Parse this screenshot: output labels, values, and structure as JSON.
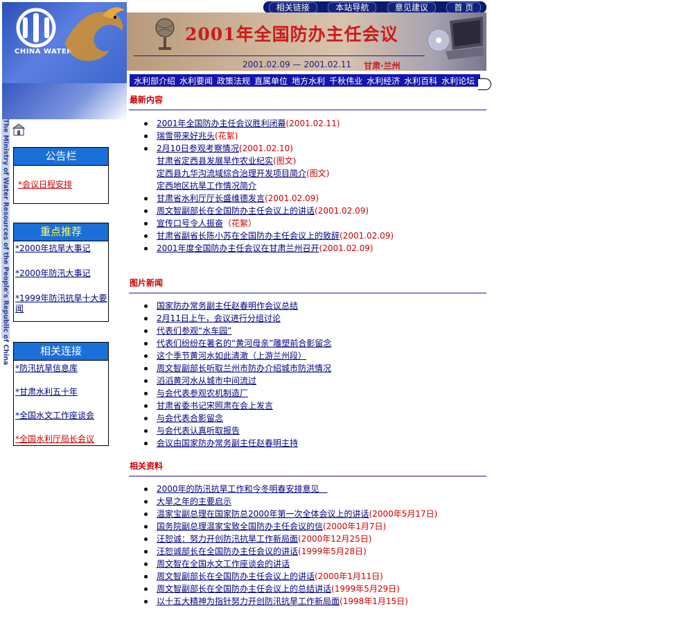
{
  "logo": {
    "text": "CHINA WATER"
  },
  "top_nav": [
    "相关链接",
    "本站导航",
    "意见建议",
    "首 页"
  ],
  "banner": {
    "title": "2001年全国防办主任会议",
    "dates": "2001.02.09 — 2001.02.11",
    "place": "甘肃·兰州"
  },
  "sub_nav": [
    "水利部介绍",
    "水利要闻",
    "政策法规",
    "直属单位",
    "地方水利",
    "千秋伟业",
    "水利经济",
    "水利百科",
    "水利论坛"
  ],
  "side_text": "The Ministry of Water Resources of the People's Republic of China",
  "sidebar": {
    "notice": {
      "title": "公告栏",
      "items": [
        "*会议日程安排"
      ]
    },
    "featured": {
      "title": "重点推荐",
      "items": [
        "*2000年抗旱大事记",
        "*2000年防汛大事记",
        "*1999年防汛抗旱十大要闻"
      ]
    },
    "links": {
      "title": "相关连接",
      "items": [
        "*防汛抗旱信息库",
        "*甘肃水利五十年",
        "*全国水文工作座谈会",
        "*全国水利厅局长会议"
      ]
    }
  },
  "sections": [
    {
      "title": "最新内容",
      "items": [
        {
          "text": "2001年全国防办主任会议胜利闭幕",
          "meta": "(2001.02.11)",
          "bullet": true
        },
        {
          "text": "瑞雪带来好兆头",
          "meta": "(花絮)",
          "bullet": true
        },
        {
          "text": "2月10日参观考察情况",
          "meta": "(2001.02.10)",
          "bullet": true
        },
        {
          "text": "甘肃省定西县发展旱作农业纪实",
          "meta": "(图文)",
          "bullet": false
        },
        {
          "text": "定西县九华沟流域综合治理开发项目简介",
          "meta": "(图文)",
          "bullet": false
        },
        {
          "text": "定西地区抗旱工作情况简介",
          "meta": "",
          "bullet": false
        },
        {
          "text": "甘肃省水利厅厅长盛维德发言",
          "meta": "(2001.02.09)",
          "bullet": true
        },
        {
          "text": "周文智副部长在全国防办主任会议上的讲话",
          "meta": "(2001.02.09)",
          "bullet": true
        },
        {
          "text": "宣传口号令人振奋",
          "meta": "（花絮）",
          "bullet": true
        },
        {
          "text": "甘肃省副省长陈小苏在全国防办主任会议上的致辞",
          "meta": "(2001.02.09)",
          "bullet": true
        },
        {
          "text": "2001年度全国防办主任会议在甘肃兰州召开",
          "meta": "(2001.02.09)",
          "bullet": true
        }
      ]
    },
    {
      "title": "图片新闻",
      "items": [
        {
          "text": "国家防办常务副主任赵春明作会议总结",
          "meta": "",
          "bullet": true
        },
        {
          "text": "2月11日上午，会议进行分组讨论",
          "meta": "",
          "bullet": true
        },
        {
          "text": "代表们参观“水车园”",
          "meta": "",
          "bullet": true
        },
        {
          "text": "代表们纷纷在著名的“黄河母亲”雕塑前合影留念",
          "meta": "",
          "bullet": true
        },
        {
          "text": "这个季节黄河水如此清澈（上游兰州段）",
          "meta": "",
          "bullet": true
        },
        {
          "text": "周文智副部长听取兰州市防办介绍城市防洪情况",
          "meta": "",
          "bullet": true
        },
        {
          "text": "滔滔黄河水从城市中间流过",
          "meta": "",
          "bullet": true
        },
        {
          "text": "与会代表参观农机制造厂",
          "meta": "",
          "bullet": true
        },
        {
          "text": "甘肃省委书记宋照肃在会上发言",
          "meta": "",
          "bullet": true
        },
        {
          "text": "与会代表合影留念",
          "meta": "",
          "bullet": true
        },
        {
          "text": "与会代表认真听取报告",
          "meta": "",
          "bullet": true
        },
        {
          "text": "会议由国家防办常务副主任赵春明主持",
          "meta": "",
          "bullet": true
        }
      ]
    },
    {
      "title": "相关资料",
      "items": [
        {
          "text": "2000年的防汛抗旱工作和今冬明春安排意见　",
          "meta": "",
          "bullet": true
        },
        {
          "text": "大旱之年的主要启示",
          "meta": "",
          "bullet": true
        },
        {
          "text": "温家宝副总理在国家防总2000年第一次全体会议上的讲话",
          "meta": "(2000年5月17日)",
          "bullet": true
        },
        {
          "text": "国务院副总理温家宝致全国防办主任会议的信",
          "meta": "(2000年1月7日)",
          "bullet": true
        },
        {
          "text": "汪恕诚：努力开创防汛抗旱工作新局面",
          "meta": "(2000年12月25日)",
          "bullet": true
        },
        {
          "text": "汪恕诚部长在全国防办主任会议的讲话",
          "meta": "(1999年5月28日)",
          "bullet": true
        },
        {
          "text": "周文智在全国水文工作座谈会的讲话",
          "meta": "",
          "bullet": true
        },
        {
          "text": "周文智副部长在全国防办主任会议上的讲话",
          "meta": "(2000年1月11日)",
          "bullet": true
        },
        {
          "text": "周文智副部长在全国防办主任会议上的总结讲话",
          "meta": "(1999年5月29日)",
          "bullet": true
        },
        {
          "text": "以十五大精神为指针努力开创防汛抗旱工作新局面",
          "meta": "(1998年1月15日)",
          "bullet": true
        }
      ]
    }
  ]
}
